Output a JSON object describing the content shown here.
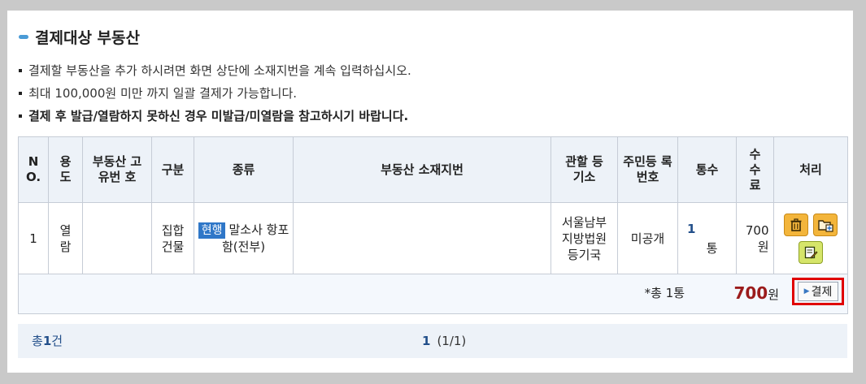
{
  "title": "결제대상 부동산",
  "notes": [
    "결제할 부동산을 추가 하시려면 화면 상단에 소재지번을 계속 입력하십시오.",
    "최대 100,000원 미만 까지 일괄 결제가 가능합니다.",
    "결제 후 발급/열람하지 못하신 경우 미발급/미열람을 참고하시기 바랍니다."
  ],
  "table": {
    "headers": {
      "no": "N O.",
      "use": "용 도",
      "unique_no": "부동산 고유번 호",
      "division": "구분",
      "kind": "종류",
      "address": "부동산 소재지번",
      "registry": "관할 등기소",
      "resident_no": "주민등 록번호",
      "copies": "통수",
      "fee": "수 수 료",
      "action": "처리"
    },
    "rows": [
      {
        "no": "1",
        "use": "열 람",
        "unique_no": "",
        "division": "집합 건물",
        "kind_badge": "현행",
        "kind": "말소사 항포함(전부)",
        "address": "",
        "registry": "서울남부 지방법원 등기국",
        "resident_no": "미공개",
        "copies_num": "1",
        "copies_unit": "통",
        "fee": "700 원"
      }
    ],
    "total_label": "*총 1통",
    "total_amount": "700",
    "total_unit": "원",
    "pay_button": "결제"
  },
  "icons": {
    "delete": "trash-icon",
    "add": "folder-add-icon",
    "edit": "edit-icon"
  },
  "footer": {
    "count_prefix": "총",
    "count_num": "1",
    "count_suffix": "건",
    "page_current": "1",
    "page_info": "(1/1)"
  },
  "colors": {
    "accent": "#2f77c8",
    "highlight_border": "#e00000",
    "amount": "#9b1b1b"
  }
}
